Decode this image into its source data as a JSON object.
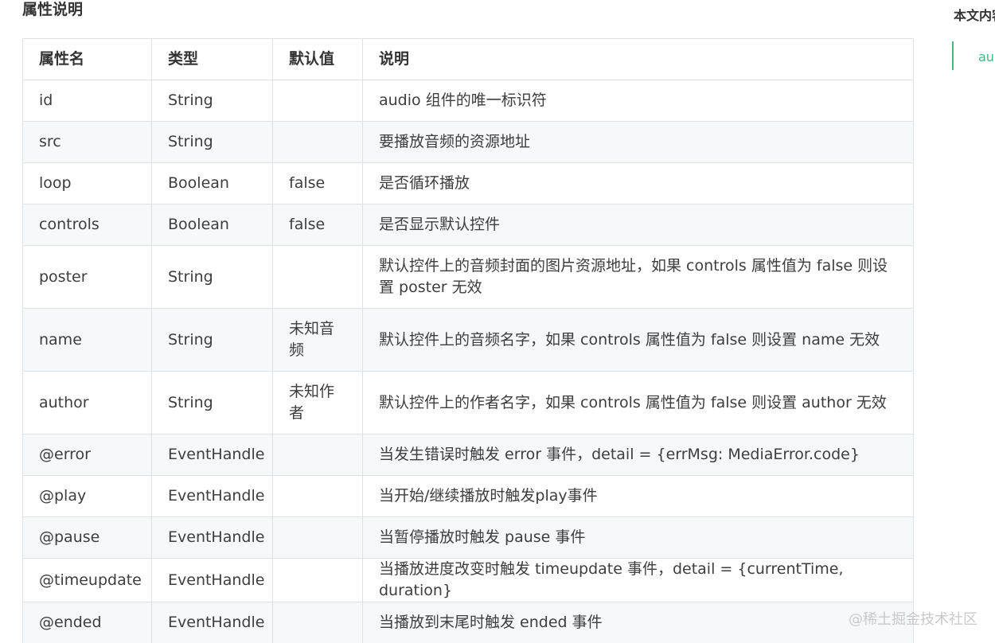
{
  "section_title": "属性说明",
  "table": {
    "headers": [
      "属性名",
      "类型",
      "默认值",
      "说明"
    ],
    "rows": [
      [
        "id",
        "String",
        "",
        "audio 组件的唯一标识符"
      ],
      [
        "src",
        "String",
        "",
        "要播放音频的资源地址"
      ],
      [
        "loop",
        "Boolean",
        "false",
        "是否循环播放"
      ],
      [
        "controls",
        "Boolean",
        "false",
        "是否显示默认控件"
      ],
      [
        "poster",
        "String",
        "",
        "默认控件上的音频封面的图片资源地址，如果 controls 属性值为 false 则设置 poster 无效"
      ],
      [
        "name",
        "String",
        "未知音频",
        "默认控件上的音频名字，如果 controls 属性值为 false 则设置 name 无效"
      ],
      [
        "author",
        "String",
        "未知作者",
        "默认控件上的作者名字，如果 controls 属性值为 false 则设置 author 无效"
      ],
      [
        "@error",
        "EventHandle",
        "",
        "当发生错误时触发 error 事件，detail = {errMsg: MediaError.code}"
      ],
      [
        "@play",
        "EventHandle",
        "",
        "当开始/继续播放时触发play事件"
      ],
      [
        "@pause",
        "EventHandle",
        "",
        "当暂停播放时触发 pause 事件"
      ],
      [
        "@timeupdate",
        "EventHandle",
        "",
        "当播放进度改变时触发 timeupdate 事件，detail = {currentTime, duration}"
      ],
      [
        "@ended",
        "EventHandle",
        "",
        "当播放到末尾时触发 ended 事件"
      ]
    ]
  },
  "toc": {
    "title": "本文内容",
    "items": [
      "audio"
    ]
  },
  "watermark": "@稀土掘金技术社区",
  "colors": {
    "accent": "#42b983",
    "border": "#dfe2e5",
    "stripe": "#f6f8fa"
  }
}
